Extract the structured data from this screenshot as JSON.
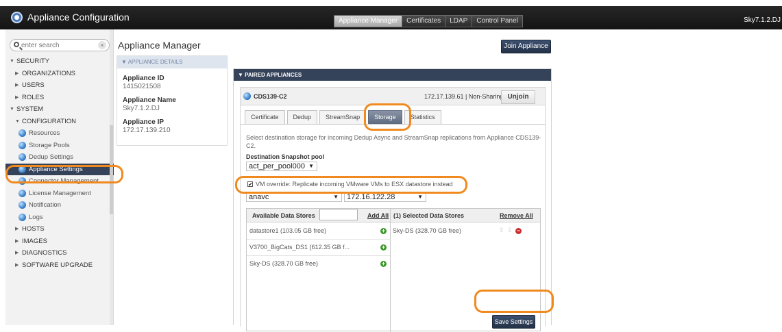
{
  "app": {
    "title": "Appliance Configuration",
    "version": "Sky7.1.2.DJ"
  },
  "top_nav": [
    {
      "label": "Appliance Manager",
      "active": true
    },
    {
      "label": "Certificates",
      "active": false
    },
    {
      "label": "LDAP",
      "active": false
    },
    {
      "label": "Control Panel",
      "active": false
    }
  ],
  "sidebar": {
    "search_placeholder": "enter search",
    "clear_symbol": "×",
    "items": [
      {
        "label": "SECURITY",
        "arrow": "▼"
      },
      {
        "label": "ORGANIZATIONS",
        "arrow": "▶"
      },
      {
        "label": "USERS",
        "arrow": "▶"
      },
      {
        "label": "ROLES",
        "arrow": "▶"
      },
      {
        "label": "SYSTEM",
        "arrow": "▼"
      },
      {
        "label": "CONFIGURATION",
        "arrow": "▼"
      },
      {
        "label": "Resources"
      },
      {
        "label": "Storage Pools"
      },
      {
        "label": "Dedup Settings"
      },
      {
        "label": "Appliance Settings"
      },
      {
        "label": "Connector Management"
      },
      {
        "label": "License Management"
      },
      {
        "label": "Notification"
      },
      {
        "label": "Logs"
      },
      {
        "label": "HOSTS",
        "arrow": "▶"
      },
      {
        "label": "IMAGES",
        "arrow": "▶"
      },
      {
        "label": "DIAGNOSTICS",
        "arrow": "▶"
      },
      {
        "label": "SOFTWARE UPGRADE",
        "arrow": "▶"
      }
    ]
  },
  "main": {
    "title": "Appliance Manager",
    "join_button": "Join Appliance",
    "details": {
      "header": "▼ APPLIANCE DETAILS",
      "id_label": "Appliance ID",
      "id_value": "1415021508",
      "name_label": "Appliance Name",
      "name_value": "Sky7.1.2.DJ",
      "ip_label": "Appliance IP",
      "ip_value": "172.17.139.210"
    },
    "paired": {
      "header": "▼ PAIRED APPLIANCES",
      "device_name": "CDS139-C2",
      "device_status": "172.17.139.61 | Non-Sharing",
      "unjoin": "Unjoin",
      "tabs": [
        "Certificate",
        "Dedup",
        "StreamSnap",
        "Storage",
        "Statistics"
      ],
      "active_tab": "Storage",
      "description": "Select destination storage for incoming Dedup Async and StreamSnap replications from Appliance CDS139-C2.",
      "pool_label": "Destination Snapshot pool",
      "pool_value": "act_per_pool000",
      "vm_override_checked": true,
      "vm_override_label": "VM override: Replicate incoming VMware VMs to ESX datastore instead",
      "vcenter_value": "anavc",
      "host_value": "172.16.122.28",
      "datastores": {
        "available_header": "Available Data Stores",
        "add_all": "Add All",
        "selected_header": "(1) Selected Data Stores",
        "remove_all": "Remove All",
        "available": [
          "datastore1 (103.05 GB free)",
          "V3700_BigCats_DS1 (612.35 GB f...",
          "Sky-DS (328.70 GB free)"
        ],
        "selected": [
          "Sky-DS (328.70 GB free)"
        ]
      },
      "save_button": "Save Settings"
    }
  },
  "colors": {
    "accent_highlight": "#f0891e",
    "header_navy": "#34435a",
    "add_green": "#3c9a2a",
    "remove_red": "#c92b2b"
  }
}
